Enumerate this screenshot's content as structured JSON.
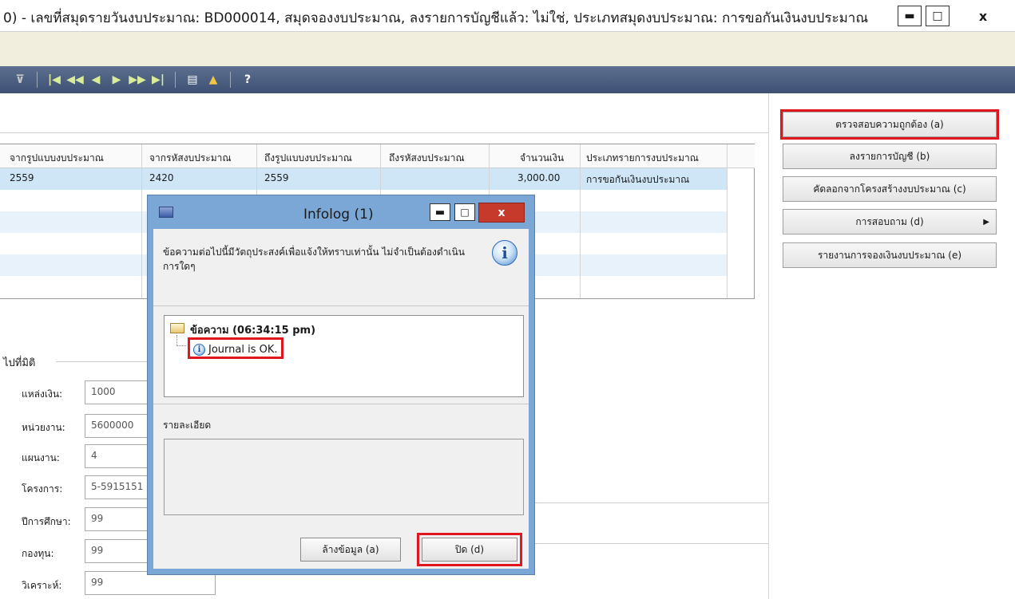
{
  "window": {
    "title": "0) - เลขที่สมุดรายวันงบประมาณ: BD000014, สมุดจองงบประมาณ, ลงรายการบัญชีแล้ว: ไม่ใช่, ประเภทสมุดงบประมาณ: การขอกันเงินงบประมาณ",
    "minimize": "▬",
    "maximize": "□",
    "close": "x"
  },
  "toolbar": {
    "icons": [
      "filter-clear-icon",
      "first-record-icon",
      "previous-page-icon",
      "previous-record-icon",
      "next-record-icon",
      "next-page-icon",
      "last-record-icon",
      "attachments-icon",
      "alert-icon",
      "help-icon"
    ]
  },
  "grid": {
    "columns": [
      "จากรูปแบบงบประมาณ",
      "จากรหัสงบประมาณ",
      "ถึงรูปแบบงบประมาณ",
      "ถึงรหัสงบประมาณ",
      "จำนวนเงิน",
      "ประเภทรายการงบประมาณ"
    ],
    "rows": [
      [
        "2559",
        "2420",
        "2559",
        "",
        "3,000.00",
        "การขอกันเงินงบประมาณ"
      ]
    ]
  },
  "actions": {
    "validate": "ตรวจสอบความถูกต้อง (a)",
    "post": "ลงรายการบัญชี (b)",
    "copy_from_structure": "คัดลอกจากโครงสร้างงบประมาณ (c)",
    "inquiry": "การสอบถาม (d)",
    "report": "รายงานการจองเงินงบประมาณ (e)"
  },
  "dimensions": {
    "group_label": "ไปที่มิติ",
    "fields": [
      {
        "label": "แหล่งเงิน:",
        "value": "1000"
      },
      {
        "label": "หน่วยงาน:",
        "value": "5600000"
      },
      {
        "label": "แผนงาน:",
        "value": "4"
      },
      {
        "label": "โครงการ:",
        "value": "5-5915151"
      },
      {
        "label": "ปีการศึกษา:",
        "value": "99"
      },
      {
        "label": "กองทุน:",
        "value": "99"
      },
      {
        "label": "วิเคราะห์:",
        "value": "99"
      }
    ]
  },
  "infolog": {
    "title": "Infolog (1)",
    "minimize": "▬",
    "maximize": "□",
    "close": "x",
    "message": "ข้อความต่อไปนี้มีวัตถุประสงค์เพื่อแจ้งให้ทราบเท่านั้น ไม่จำเป็นต้องดำเนินการใดๆ",
    "info_glyph": "i",
    "tree_header": "ข้อความ (06:34:15 pm)",
    "tree_item": "Journal is OK.",
    "details_label": "รายละเอียด",
    "clear_button": "ล้างข้อมูล (a)",
    "close_button": "ปิด (d)"
  }
}
